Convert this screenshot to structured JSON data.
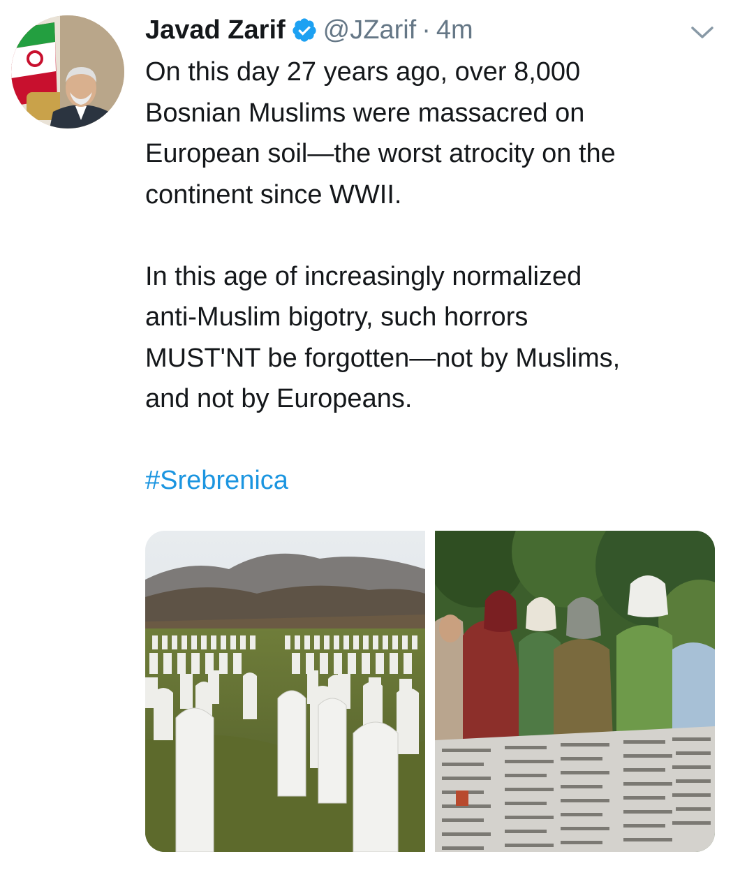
{
  "tweet": {
    "author": {
      "display_name": "Javad Zarif",
      "handle": "@JZarif",
      "verified_icon": "verified-badge-icon",
      "avatar": "profile-photo"
    },
    "separator": "·",
    "timestamp": "4m",
    "menu_icon": "chevron-down-icon",
    "text": {
      "paragraph_1": "On this day 27 years ago, over 8,000\nBosnian Muslims were massacred on\nEuropean soil—the worst atrocity on the\ncontinent since WWII.",
      "paragraph_2": "In this age of increasingly normalized\nanti-Muslim bigotry, such horrors\nMUST'NT be forgotten—not by Muslims,\nand not by Europeans.",
      "hashtag": "#Srebrenica"
    },
    "media": [
      {
        "name": "cemetery-photo",
        "description": "white gravestones on grassy hill"
      },
      {
        "name": "memorial-photo",
        "description": "women standing at memorial wall of names"
      }
    ],
    "colors": {
      "text": "#14171a",
      "secondary": "#657786",
      "link": "#1b95e0",
      "verified": "#1da1f2"
    }
  }
}
